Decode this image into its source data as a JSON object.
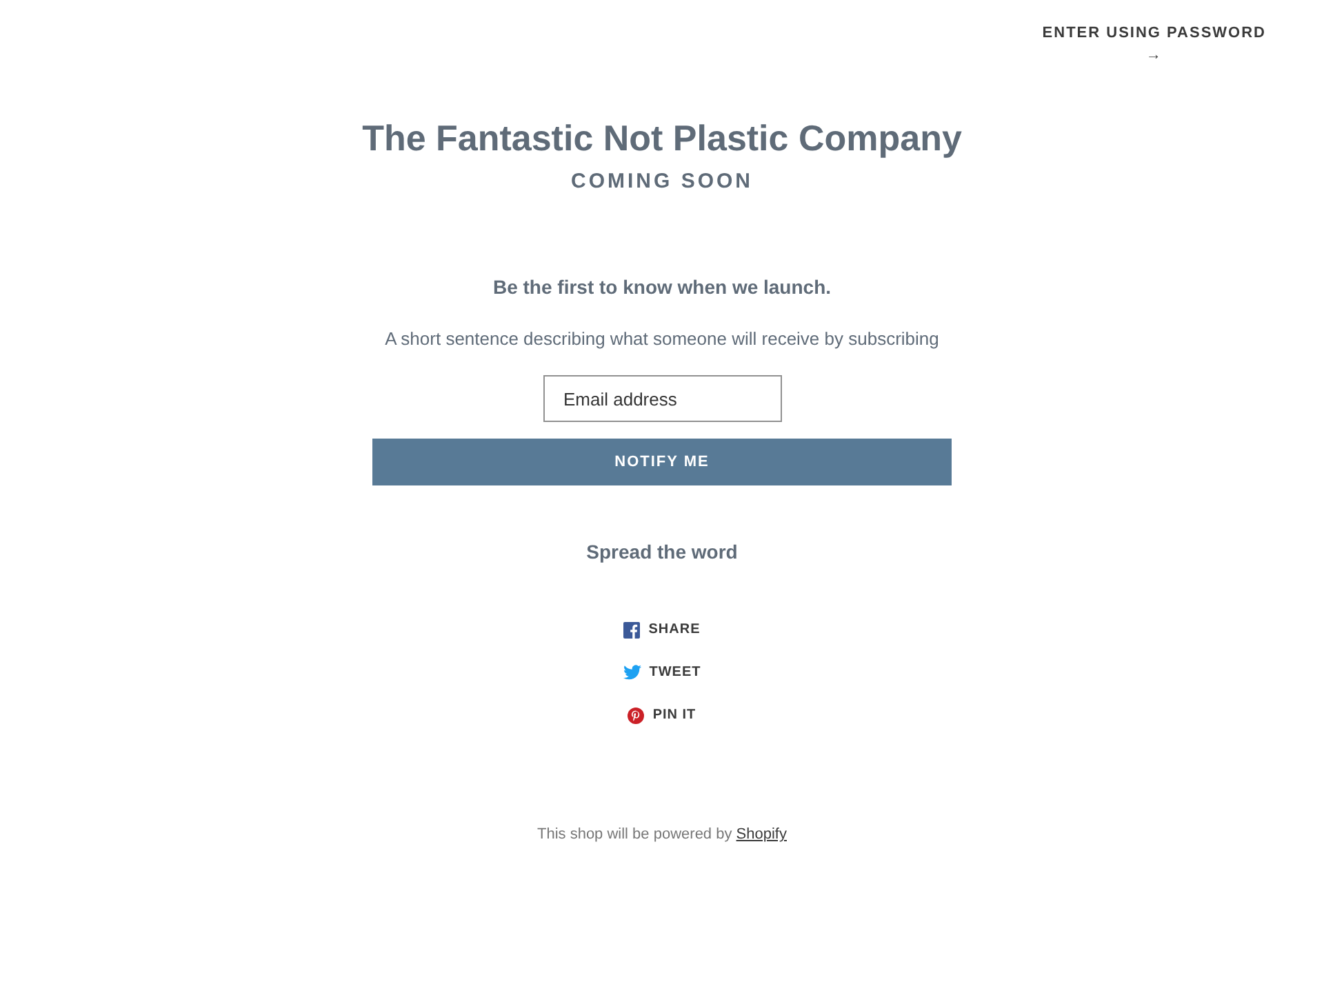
{
  "header": {
    "password_link": "ENTER USING PASSWORD",
    "arrow": "→"
  },
  "title": "The Fantastic Not Plastic Company",
  "subtitle": "COMING SOON",
  "signup": {
    "heading": "Be the first to know when we launch.",
    "description": "A short sentence describing what someone will receive by subscribing",
    "email": {
      "placeholder": "Email address"
    },
    "button": "NOTIFY ME"
  },
  "share": {
    "heading": "Spread the word",
    "links": [
      {
        "kind": "facebook",
        "label": "SHARE"
      },
      {
        "kind": "twitter",
        "label": "TWEET"
      },
      {
        "kind": "pinterest",
        "label": "PIN IT"
      }
    ]
  },
  "footer": {
    "text": "This shop will be powered by",
    "link": "Shopify"
  }
}
